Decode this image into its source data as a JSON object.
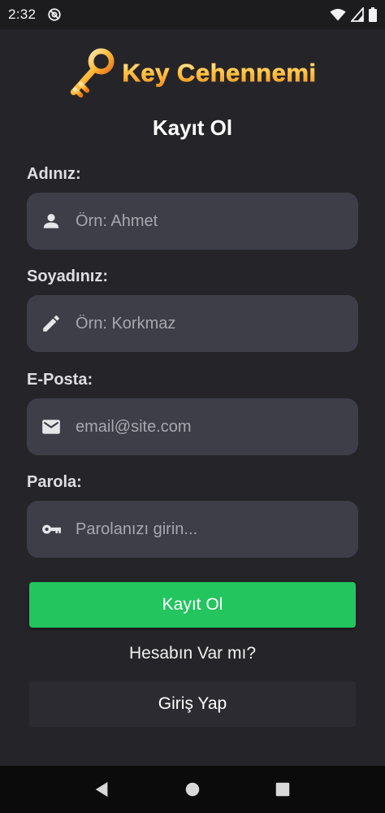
{
  "status_bar": {
    "time": "2:32"
  },
  "logo": {
    "text": "Key Cehennemi"
  },
  "page": {
    "title": "Kayıt Ol"
  },
  "form": {
    "first_name": {
      "label": "Adınız:",
      "placeholder": "Örn: Ahmet",
      "icon": "person-icon"
    },
    "last_name": {
      "label": "Soyadınız:",
      "placeholder": "Örn: Korkmaz",
      "icon": "pencil-icon"
    },
    "email": {
      "label": "E-Posta:",
      "placeholder": "email@site.com",
      "icon": "mail-icon"
    },
    "password": {
      "label": "Parola:",
      "placeholder": "Parolanızı girin...",
      "icon": "key-icon"
    }
  },
  "actions": {
    "register_label": "Kayıt Ol",
    "have_account_text": "Hesabın Var mı?",
    "login_label": "Giriş Yap"
  },
  "colors": {
    "background": "#252529",
    "field_background": "#3e3e48",
    "primary": "#22c55e",
    "secondary_button": "#2b2b31",
    "logo_orange": "#f5a623"
  }
}
